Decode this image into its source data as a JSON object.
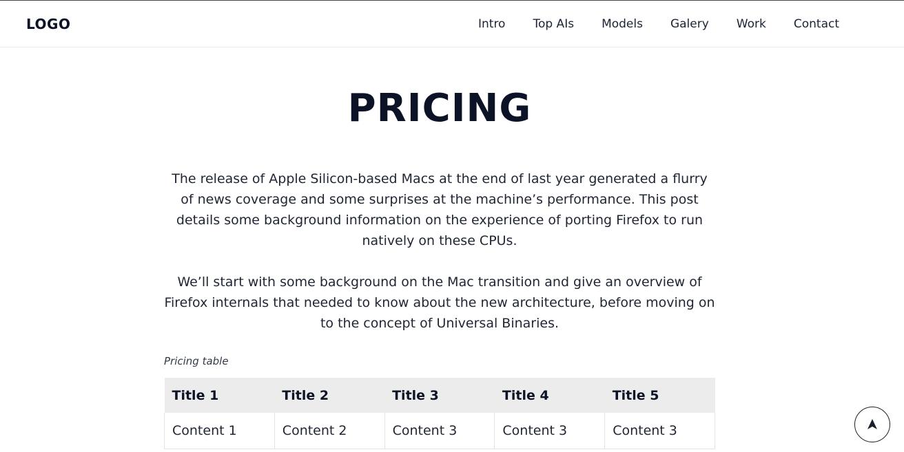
{
  "header": {
    "logo": "LOGO",
    "nav": [
      {
        "label": "Intro"
      },
      {
        "label": "Top AIs"
      },
      {
        "label": "Models"
      },
      {
        "label": "Galery"
      },
      {
        "label": "Work"
      },
      {
        "label": "Contact"
      }
    ]
  },
  "main": {
    "title": "PRICING",
    "paragraphs": [
      "The release of Apple Silicon-based Macs at the end of last year generated a flurry of news coverage and some surprises at the machine’s performance. This post details some background information on the experience of porting Firefox to run natively on these CPUs.",
      "We’ll start with some background on the Mac transition and give an overview of Firefox internals that needed to know about the new architecture, before moving on to the concept of Universal Binaries."
    ],
    "table": {
      "caption": "Pricing table",
      "headers": [
        "Title 1",
        "Title 2",
        "Title 3",
        "Title 4",
        "Title 5"
      ],
      "rows": [
        [
          "Content 1",
          "Content 2",
          "Content 3",
          "Content 3",
          "Content 3"
        ]
      ]
    }
  },
  "fab": {
    "icon": "arrow-up-icon"
  }
}
